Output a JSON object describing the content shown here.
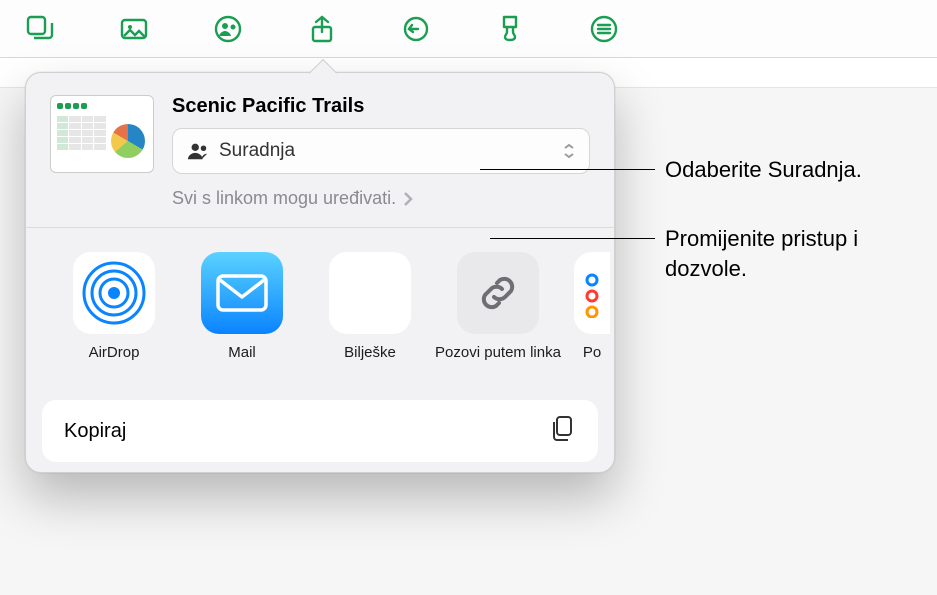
{
  "title": "Scenic Pacific Trails",
  "selectorLabel": "Suradnja",
  "permissions": "Svi s linkom mogu uređivati.",
  "apps": [
    "AirDrop",
    "Mail",
    "Bilješke",
    "Pozovi putem linka",
    "Po"
  ],
  "copyLabel": "Kopiraj",
  "callout1": "Odaberite Suradnja.",
  "callout2": "Promijenite pristup i dozvole."
}
